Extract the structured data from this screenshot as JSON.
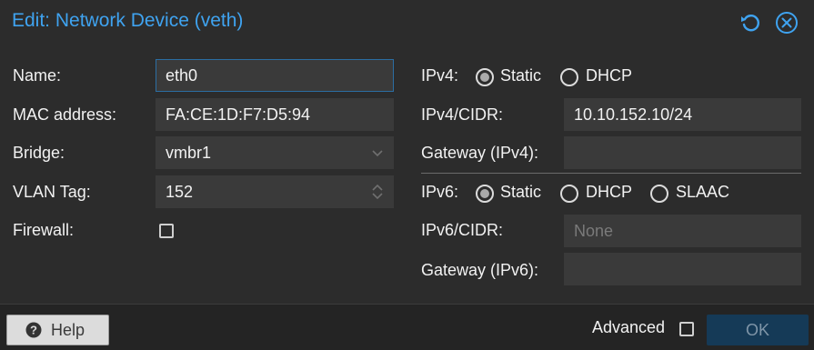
{
  "dialog": {
    "title": "Edit: Network Device (veth)",
    "reset_icon": "reset-icon",
    "close_icon": "close-circle-icon",
    "accent_color": "#3fa3f0"
  },
  "left": {
    "name": {
      "label": "Name:",
      "value": "eth0"
    },
    "mac": {
      "label": "MAC address:",
      "value": "FA:CE:1D:F7:D5:94"
    },
    "bridge": {
      "label": "Bridge:",
      "value": "vmbr1"
    },
    "vlan": {
      "label": "VLAN Tag:",
      "value": "152"
    },
    "firewall": {
      "label": "Firewall:",
      "checked": false
    }
  },
  "right": {
    "ipv4": {
      "label": "IPv4:",
      "options": [
        "Static",
        "DHCP"
      ],
      "selected": "Static"
    },
    "ipv4_cidr": {
      "label": "IPv4/CIDR:",
      "value": "10.10.152.10/24"
    },
    "gateway_v4": {
      "label": "Gateway (IPv4):",
      "value": ""
    },
    "ipv6": {
      "label": "IPv6:",
      "options": [
        "Static",
        "DHCP",
        "SLAAC"
      ],
      "selected": "Static"
    },
    "ipv6_cidr": {
      "label": "IPv6/CIDR:",
      "placeholder": "None"
    },
    "gateway_v6": {
      "label": "Gateway (IPv6):",
      "value": ""
    }
  },
  "footer": {
    "help_label": "Help",
    "advanced_label": "Advanced",
    "advanced_checked": false,
    "ok_label": "OK"
  }
}
